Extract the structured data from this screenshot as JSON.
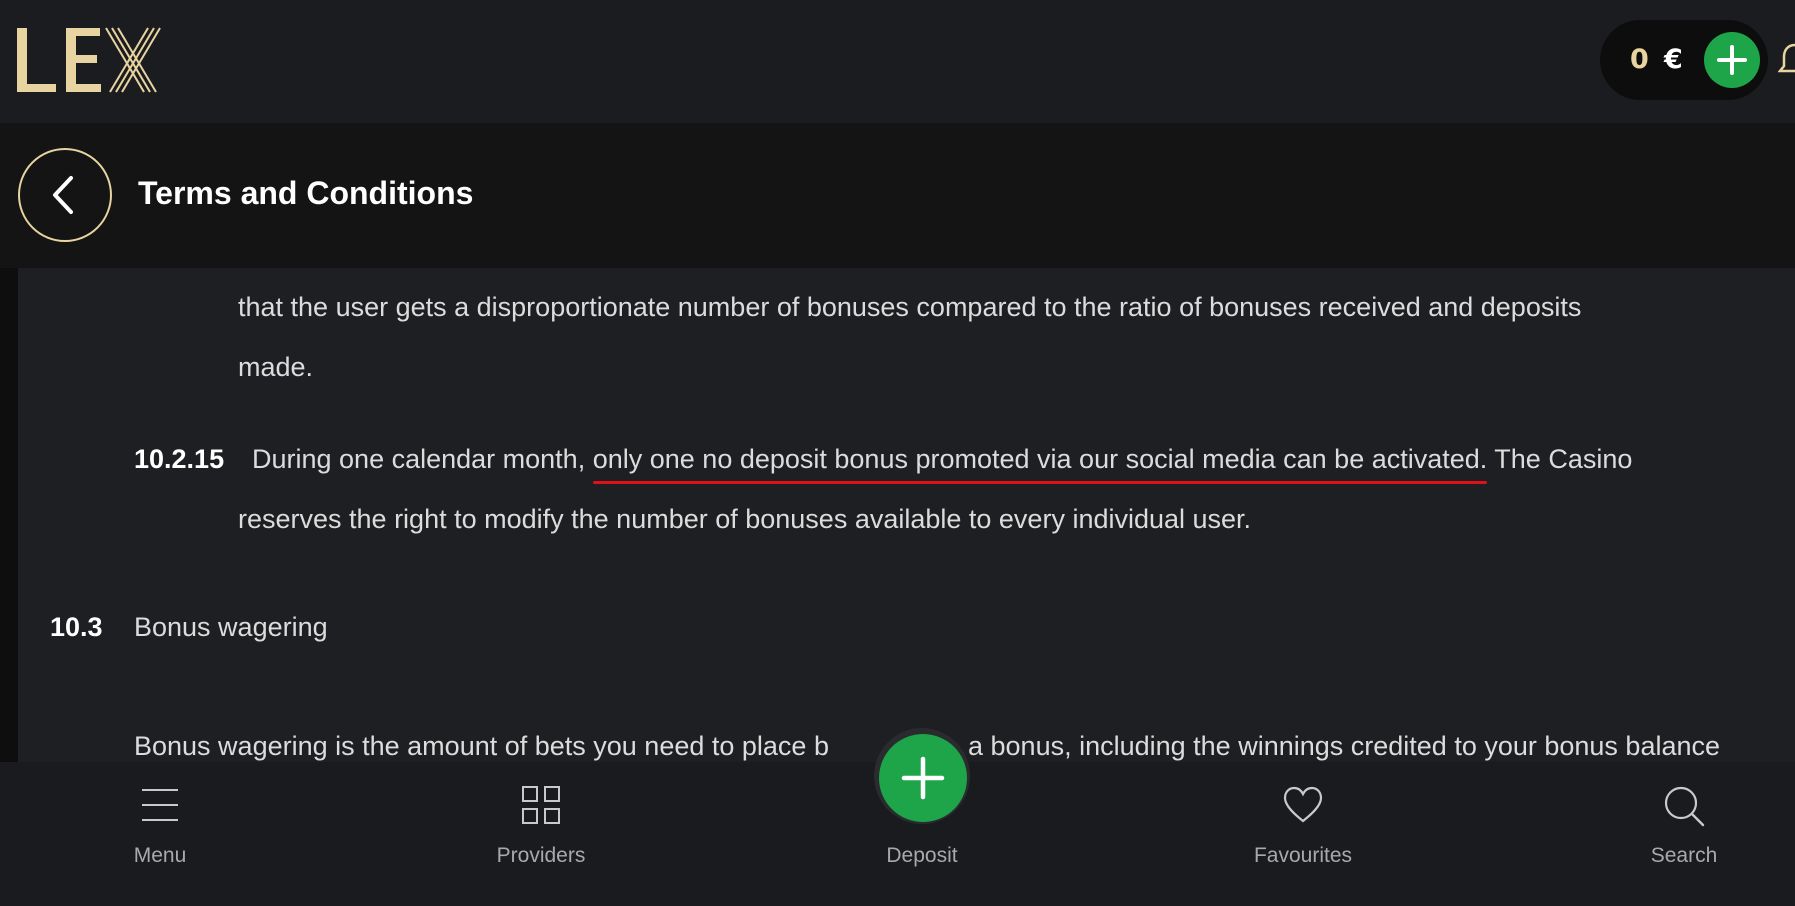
{
  "header": {
    "logo_text": "LEX",
    "balance_amount": "0",
    "balance_currency": "€",
    "brand_color": "#e8d4a0",
    "accent_color": "#1ea54a"
  },
  "titlebar": {
    "title": "Terms and Conditions"
  },
  "content": {
    "para_prev_line1": "that the user gets a disproportionate number of bonuses compared to the ratio of bonuses received and deposits",
    "para_prev_line2": "made.",
    "clause_10_2_15": {
      "number": "10.2.15",
      "text_before": "During one calendar month, ",
      "text_highlighted": "only one no deposit bonus promoted via our social media can be activated.",
      "text_after": " The Casino",
      "line2": "reserves the right to modify the number of bonuses available to every individual user."
    },
    "section_10_3": {
      "number": "10.3",
      "title": "Bonus wagering"
    },
    "wagering_text_start": "Bonus wagering is the amount of bets you need to place b",
    "wagering_text_end": "a bonus, including the winnings credited to your bonus balance",
    "highlight_color": "#e0101a"
  },
  "bottom_nav": {
    "items": [
      {
        "label": "Menu",
        "icon": "menu-icon"
      },
      {
        "label": "Providers",
        "icon": "grid-icon"
      },
      {
        "label": "Deposit",
        "icon": "plus-icon"
      },
      {
        "label": "Favourites",
        "icon": "heart-icon"
      },
      {
        "label": "Search",
        "icon": "search-icon"
      }
    ]
  }
}
